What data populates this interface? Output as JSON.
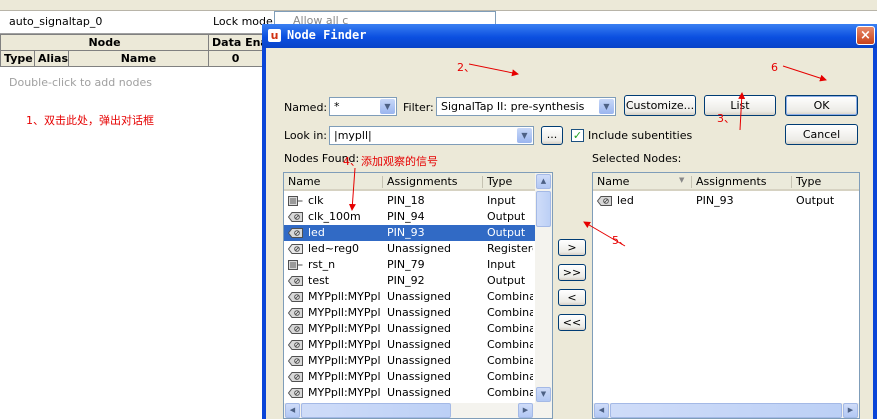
{
  "background": {
    "instance": "auto_signaltap_0",
    "lock_mode_label": "Lock mode:",
    "lock_mode_value": "Allow all c",
    "node_header": "Node",
    "data_enable_header": "Data Enab",
    "col_type": "Type",
    "col_alias": "Alias",
    "col_name": "Name",
    "data_enable_value": "0",
    "hint": "Double-click to add nodes"
  },
  "annotations": {
    "a1": "1、双击此处，弹出对话框",
    "a2": "2、",
    "a3": "3、",
    "a4": "4、添加观察的信号",
    "a5": "5、",
    "a6": "6"
  },
  "dialog": {
    "title": "Node Finder",
    "app_icon": "u",
    "close": "×",
    "named_label": "Named:",
    "named_value": "*",
    "filter_label": "Filter:",
    "filter_value": "SignalTap II: pre-synthesis",
    "customize_btn": "Customize...",
    "list_btn": "List",
    "ok_btn": "OK",
    "cancel_btn": "Cancel",
    "lookin_label": "Look in:",
    "lookin_value": "|mypll|",
    "browse_btn": "...",
    "include_subentities": "Include subentities",
    "nodes_found_label": "Nodes Found:",
    "selected_nodes_label": "Selected Nodes:",
    "found_columns": [
      "Name",
      "Assignments",
      "Type"
    ],
    "selected_columns": [
      "Name",
      "Assignments",
      "Type"
    ],
    "found_rows": [
      {
        "name": "clk",
        "assignment": "PIN_18",
        "type": "Input",
        "icon": "input-pin-icon"
      },
      {
        "name": "clk_100m",
        "assignment": "PIN_94",
        "type": "Output",
        "icon": "output-pin-icon"
      },
      {
        "name": "led",
        "assignment": "PIN_93",
        "type": "Output",
        "icon": "output-pin-icon",
        "selected": true
      },
      {
        "name": "led~reg0",
        "assignment": "Unassigned",
        "type": "Registered",
        "icon": "register-icon"
      },
      {
        "name": "rst_n",
        "assignment": "PIN_79",
        "type": "Input",
        "icon": "input-pin-icon"
      },
      {
        "name": "test",
        "assignment": "PIN_92",
        "type": "Output",
        "icon": "output-pin-icon"
      },
      {
        "name": "MYPpll:MYPpl...",
        "assignment": "Unassigned",
        "type": "Combinat",
        "icon": "combinational-icon"
      },
      {
        "name": "MYPpll:MYPpl...",
        "assignment": "Unassigned",
        "type": "Combinat",
        "icon": "combinational-icon"
      },
      {
        "name": "MYPpll:MYPpl...",
        "assignment": "Unassigned",
        "type": "Combinat",
        "icon": "combinational-icon"
      },
      {
        "name": "MYPpll:MYPpl...",
        "assignment": "Unassigned",
        "type": "Combinat",
        "icon": "combinational-icon"
      },
      {
        "name": "MYPpll:MYPpl...",
        "assignment": "Unassigned",
        "type": "Combinat",
        "icon": "combinational-icon"
      },
      {
        "name": "MYPpll:MYPpl...",
        "assignment": "Unassigned",
        "type": "Combinat",
        "icon": "combinational-icon"
      },
      {
        "name": "MYPpll:MYPpl...",
        "assignment": "Unassigned",
        "type": "Combinat",
        "icon": "combinational-icon"
      },
      {
        "name": "MYPpll:MYPpl...",
        "assignment": "Unassigned",
        "type": "Combinat",
        "icon": "combinational-icon"
      }
    ],
    "selected_rows": [
      {
        "name": "led",
        "assignment": "PIN_93",
        "type": "Output",
        "icon": "output-pin-icon"
      }
    ],
    "move_buttons": [
      ">",
      ">>",
      "<",
      "<<"
    ]
  },
  "colors": {
    "title_bar": "#0b4fe0",
    "selection": "#316ac5",
    "annotation": "#e60000",
    "dialog_face": "#ece9d8"
  }
}
